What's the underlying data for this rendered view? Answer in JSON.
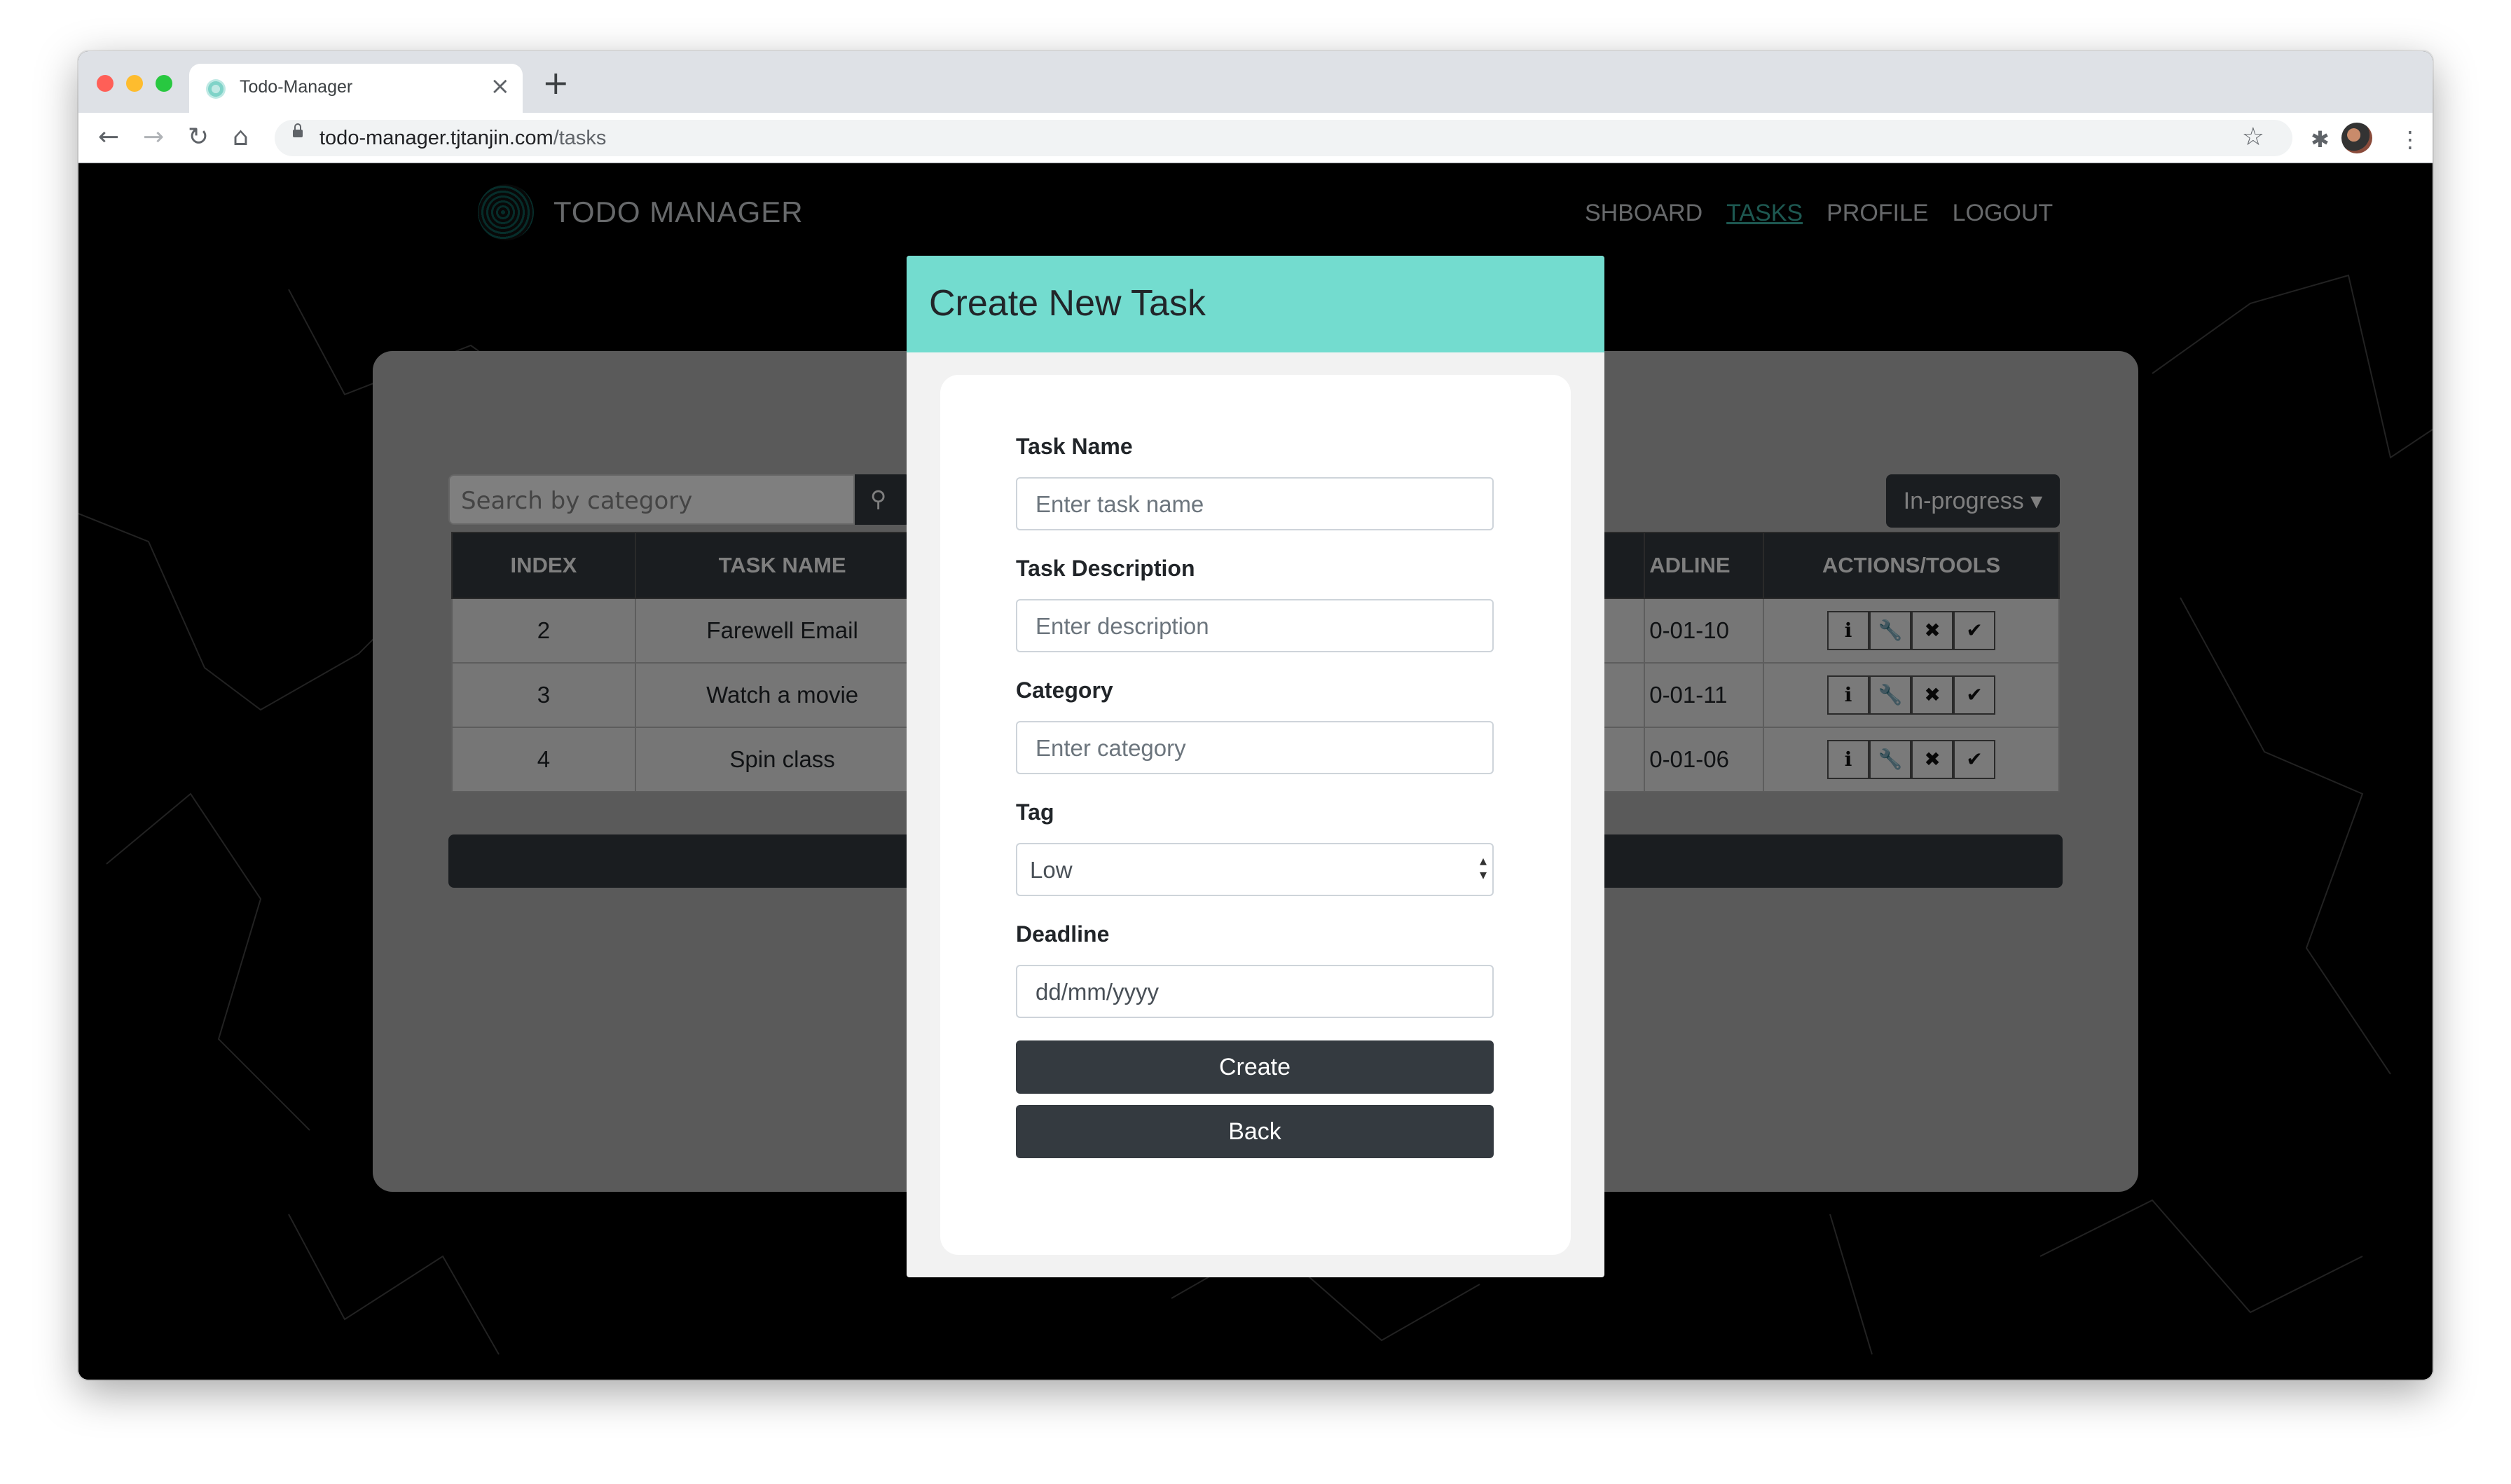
{
  "browser": {
    "tab_title": "Todo-Manager",
    "tab_close": "×",
    "new_tab": "+",
    "url_host": "todo-manager.tjtanjin.com",
    "url_path": "/tasks",
    "back": "←",
    "forward": "→",
    "reload": "↻",
    "home": "⌂",
    "star": "☆",
    "extensions": "✱",
    "menu": "⋮"
  },
  "site": {
    "brand": "TODO MANAGER",
    "nav": [
      "SHBOARD",
      "TASKS",
      "PROFILE",
      "LOGOUT"
    ],
    "active_nav": "TASKS"
  },
  "tasks": {
    "search_placeholder": "Search by category",
    "search_icon": "🔍",
    "filter_label": "In-progress ▾",
    "headers": {
      "index": "INDEX",
      "name": "TASK NAME",
      "deadline": "ADLINE",
      "actions": "ACTIONS/TOOLS"
    },
    "rows": [
      {
        "index": "2",
        "name": "Farewell Email",
        "deadline": "0-01-10"
      },
      {
        "index": "3",
        "name": "Watch a movie",
        "deadline": "0-01-11"
      },
      {
        "index": "4",
        "name": "Spin class",
        "deadline": "0-01-06"
      }
    ],
    "tool_icons": [
      "info-icon",
      "wrench-icon",
      "close-icon",
      "check-icon"
    ]
  },
  "modal": {
    "title": "Create New Task",
    "task_name_label": "Task Name",
    "task_name_placeholder": "Enter task name",
    "desc_label": "Task Description",
    "desc_placeholder": "Enter description",
    "category_label": "Category",
    "category_placeholder": "Enter category",
    "tag_label": "Tag",
    "tag_value": "Low",
    "deadline_label": "Deadline",
    "deadline_placeholder": "dd/mm/yyyy",
    "create_button": "Create",
    "back_button": "Back"
  },
  "colors": {
    "accent": "#73dccf",
    "dark": "#343a40",
    "nav_active": "#3ab0a3"
  }
}
